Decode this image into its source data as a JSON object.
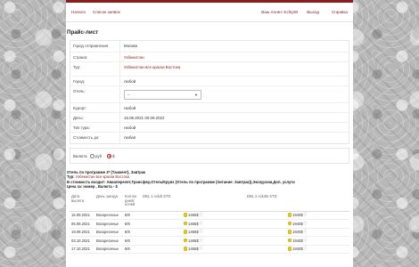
{
  "nav": {
    "left": [
      "Начало",
      "Список заявок"
    ],
    "right": [
      "Ваш логин: EchipW",
      "Выход",
      "Справка"
    ]
  },
  "title": "Прайс-лист",
  "form": {
    "departure_label": "Город отправления",
    "departure_value": "Москва",
    "country_label": "Страна:",
    "country_value": "Узбекистан",
    "tour_label": "Тур:",
    "tour_value": "Узбекистан все краски Востока",
    "city_label": "Город:",
    "city_value": "любой",
    "hotel_label": "Отель:",
    "hotel_select": "--",
    "resort_label": "Курорт:",
    "resort_value": "любой",
    "dates_label": "Даты:",
    "dates_value": "15.09.2021-30.09.2022",
    "tourtype_label": "Тип тура:",
    "tourtype_value": "любой",
    "cost_label": "Стоимость до:",
    "cost_value": "любая"
  },
  "currency": {
    "label": "Валюта",
    "options": [
      "руб",
      "$"
    ],
    "selected": "$"
  },
  "info": {
    "hotel_line": "Отель по программе 3* (Ташкент), Завтрак",
    "tour_prefix": "Тур:",
    "tour_link": "Узбекистан все краски Востока",
    "includes_line": "В стоимость входит: Авиаперелет,Трансфер,Отель/Круиз (Отель по программе (питание: Завтрак)),Экскурсии,Доп. услуги",
    "price_line": "Цена за: номер , Валюта - $"
  },
  "table": {
    "headers": [
      "Дата вылета",
      "День заезда",
      "Кол-во дней/ ночей",
      "DBL 1 Adult STD",
      "DBL 2 Adults STD"
    ],
    "rows": [
      {
        "date": "15.09.2021",
        "day": "Воскресенье",
        "nights": "8/6",
        "p1": "1465$",
        "p2": "1940$"
      },
      {
        "date": "05.09.2021",
        "day": "Воскресенье",
        "nights": "8/6",
        "p1": "1465$",
        "p2": "1940$"
      },
      {
        "date": "19.09.2021",
        "day": "Воскресенье",
        "nights": "8/6",
        "p1": "1465$",
        "p2": "1940$"
      },
      {
        "date": "03.10.2021",
        "day": "Воскресенье",
        "nights": "8/6",
        "p1": "1465$",
        "p2": "1940$"
      },
      {
        "date": "17.10.2021",
        "day": "Воскресенье",
        "nights": "8/6",
        "p1": "1465$",
        "p2": "1940$"
      }
    ]
  },
  "colors": {
    "accent": "#8b1c1c",
    "coin": "#f0d31a"
  }
}
